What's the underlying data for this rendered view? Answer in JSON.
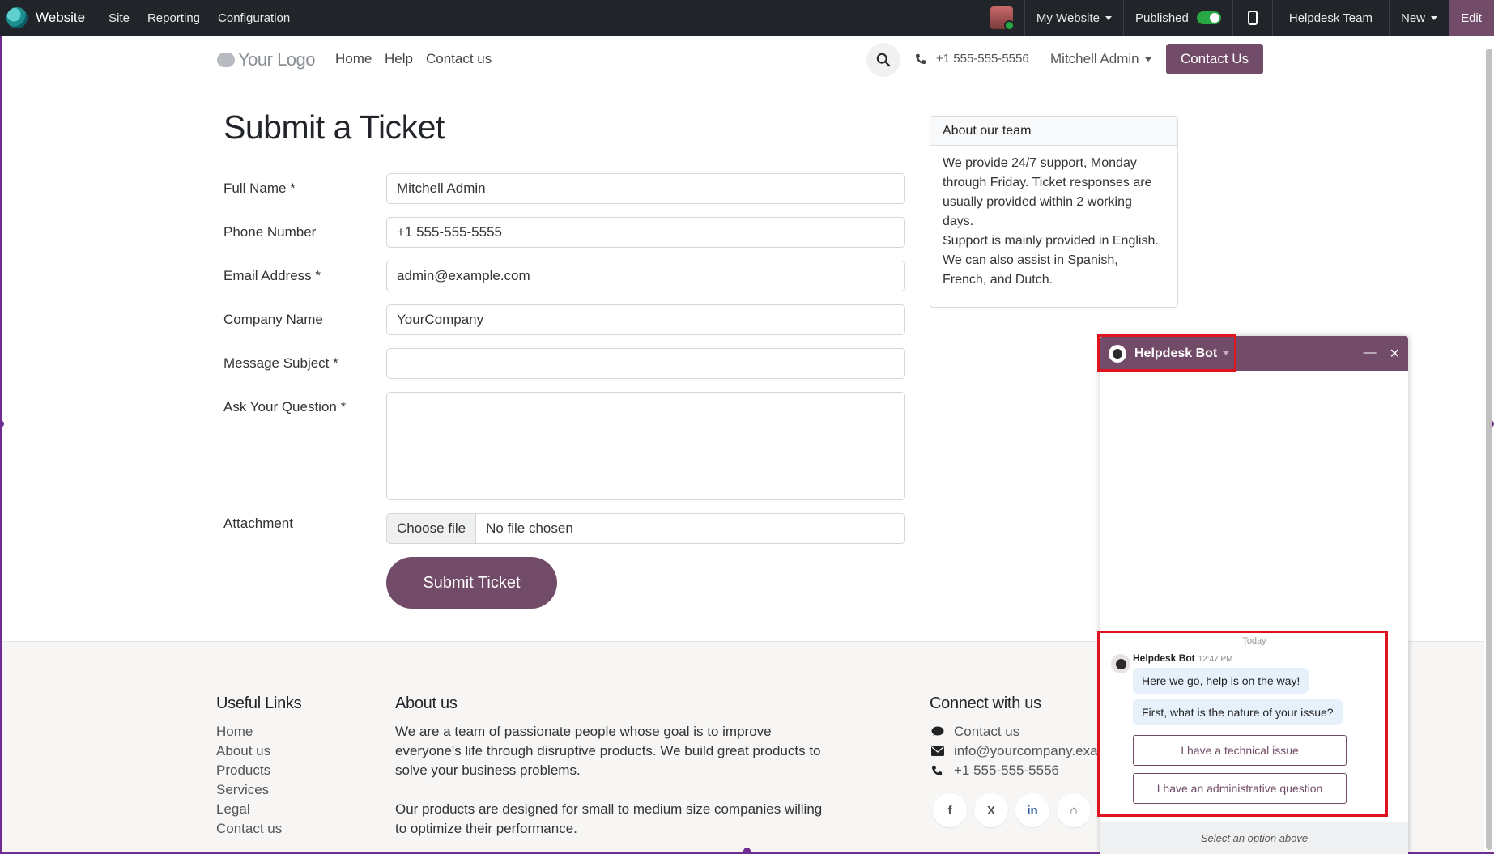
{
  "topbar": {
    "brand": "Website",
    "menu": [
      "Site",
      "Reporting",
      "Configuration"
    ],
    "my_website": "My Website",
    "published": "Published",
    "team": "Helpdesk Team",
    "new": "New",
    "edit": "Edit"
  },
  "header": {
    "logo": "Your Logo",
    "nav": [
      "Home",
      "Help",
      "Contact us"
    ],
    "phone": "+1 555-555-5556",
    "user": "Mitchell Admin",
    "cta": "Contact Us"
  },
  "form": {
    "title": "Submit a Ticket",
    "fields": [
      {
        "label": "Full Name *",
        "value": "Mitchell Admin"
      },
      {
        "label": "Phone Number",
        "value": "+1 555-555-5555"
      },
      {
        "label": "Email Address *",
        "value": "admin@example.com"
      },
      {
        "label": "Company Name",
        "value": "YourCompany"
      },
      {
        "label": "Message Subject *",
        "value": ""
      },
      {
        "label": "Ask Your Question *",
        "value": ""
      }
    ],
    "attachment_label": "Attachment",
    "choose_file": "Choose file",
    "no_file": "No file chosen",
    "submit": "Submit Ticket"
  },
  "about_card": {
    "title": "About our team",
    "p1": "We provide 24/7 support, Monday through Friday. Ticket responses are usually provided within 2 working days.",
    "p2": "Support is mainly provided in English. We can also assist in Spanish, French, and Dutch."
  },
  "footer": {
    "links_title": "Useful Links",
    "links": [
      "Home",
      "About us",
      "Products",
      "Services",
      "Legal",
      "Contact us"
    ],
    "about_title": "About us",
    "about_p1": "We are a team of passionate people whose goal is to improve everyone's life through disruptive products. We build great products to solve your business problems.",
    "about_p2": "Our products are designed for small to medium size companies willing to optimize their performance.",
    "connect_title": "Connect with us",
    "contact": "Contact us",
    "email": "info@yourcompany.exa",
    "phone": "+1 555-555-5556",
    "socials": [
      "f",
      "X",
      "in",
      "⌂"
    ]
  },
  "chat": {
    "title": "Helpdesk Bot",
    "today": "Today",
    "author": "Helpdesk Bot",
    "time": "12:47 PM",
    "messages": [
      "Here we go, help is on the way!",
      "First, what is the nature of your issue?"
    ],
    "options": [
      "I have a technical issue",
      "I have an administrative question"
    ],
    "footer": "Select an option above"
  }
}
